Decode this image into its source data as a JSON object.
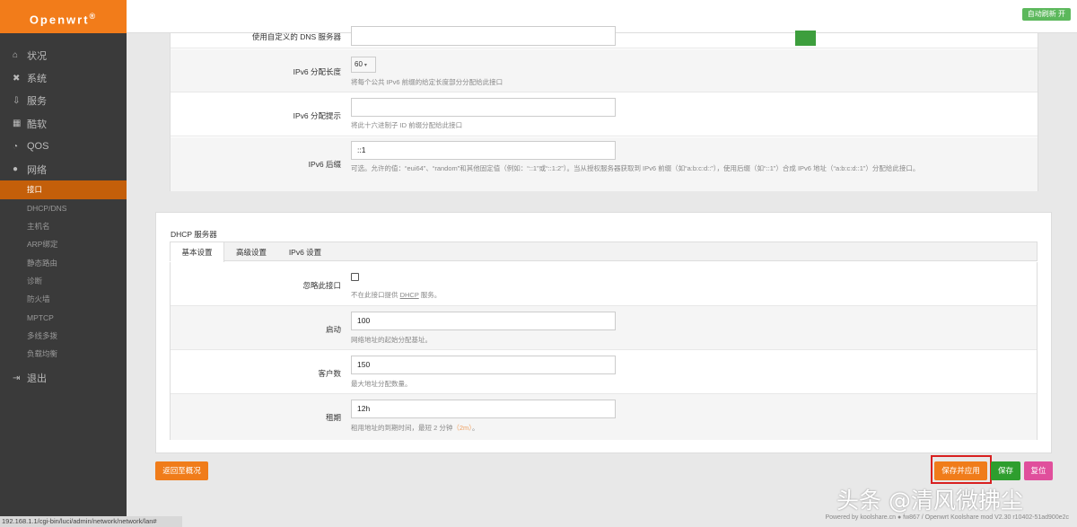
{
  "brand": {
    "name": "Openwrt",
    "mark": "®"
  },
  "sidebar": {
    "items": [
      {
        "icon": "home-icon",
        "glyph": "⌂",
        "label": "状况"
      },
      {
        "icon": "wrench-icon",
        "glyph": "✖",
        "label": "系统"
      },
      {
        "icon": "download-icon",
        "glyph": "⇩",
        "label": "服务"
      },
      {
        "icon": "calendar-icon",
        "glyph": "▦",
        "label": "酷软"
      },
      {
        "icon": "gauge-icon",
        "glyph": "◔",
        "label": "QOS"
      },
      {
        "icon": "globe-icon",
        "glyph": "●",
        "label": "网络"
      }
    ],
    "network_sub": [
      "接口",
      "DHCP/DNS",
      "主机名",
      "ARP绑定",
      "静态路由",
      "诊断",
      "防火墙",
      "MPTCP",
      "多线多拨",
      "负载均衡"
    ],
    "logout": {
      "icon": "logout-icon",
      "glyph": "⇥",
      "label": "退出"
    }
  },
  "topbar": {
    "auto_refresh": "自动刷新 开"
  },
  "ipv6_panel": {
    "dns_label": "使用自定义的 DNS 服务器",
    "assign_len_label": "IPv6 分配长度",
    "assign_len_value": "60",
    "assign_len_hint": "将每个公共 IPv6 前缀的给定长度部分分配给此接口",
    "assign_hint_label": "IPv6 分配提示",
    "assign_hint_hint": "将此十六进制子 ID 前缀分配给此接口",
    "suffix_label": "IPv6 后缀",
    "suffix_value": "::1",
    "suffix_hint": "可选。允许的值：“eui64”、“random”和其他固定值（例如：“::1”或“::1:2”）。当从授权服务器获取到 IPv6 前缀（如“a:b:c:d::”），使用后缀（如“::1”）合成 IPv6 地址（“a:b:c:d::1”）分配给此接口。"
  },
  "dhcp_panel": {
    "title": "DHCP 服务器",
    "tabs": [
      "基本设置",
      "高级设置",
      "IPv6 设置"
    ],
    "ignore_label": "忽略此接口",
    "ignore_hint_pre": "不在此接口提供 ",
    "ignore_hint_link": "DHCP",
    "ignore_hint_post": " 服务。",
    "start_label": "启动",
    "start_value": "100",
    "start_hint": "网络地址的起始分配基址。",
    "limit_label": "客户数",
    "limit_value": "150",
    "limit_hint": "最大地址分配数量。",
    "lease_label": "租期",
    "lease_value": "12h",
    "lease_hint_pre": "租用地址的到期时间，最短 2 分钟",
    "lease_hint_unit": "（2m）",
    "lease_hint_post": "。"
  },
  "actions": {
    "back": "返回至概况",
    "save_apply": "保存并应用",
    "save": "保存",
    "reset": "复位"
  },
  "status_url": "192.168.1.1/cgi-bin/luci/admin/network/network/lan#",
  "footer": "Powered by koolshare.cn ● fw867 / Openwrt Koolshare mod V2.30 r10402-51ad900e2c",
  "watermark": "头条 @清风微拂尘"
}
